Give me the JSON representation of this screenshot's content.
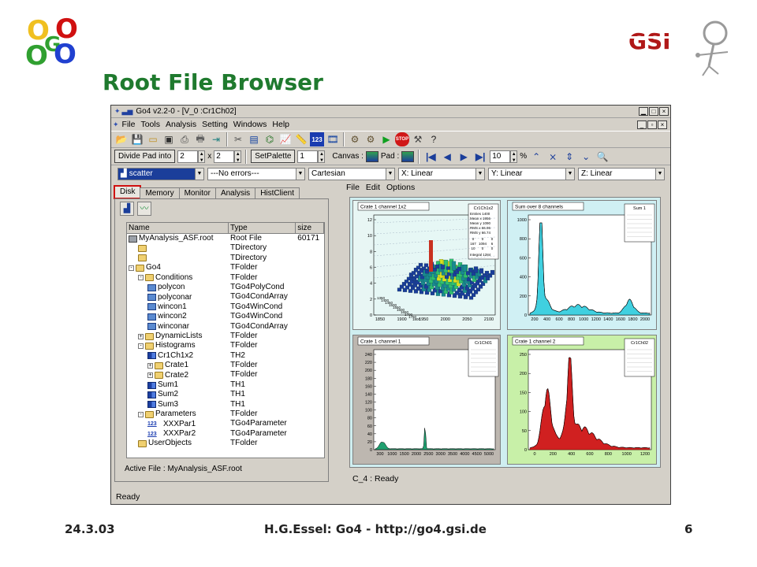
{
  "slide": {
    "title": "Root File Browser",
    "footer_date": "24.3.03",
    "footer_center": "H.G.Essel: Go4 - http://go4.gsi.de",
    "footer_page": "6",
    "logo_left_letters": [
      "O",
      "O",
      "G",
      "O",
      "O"
    ],
    "logo_right_text": "GSI"
  },
  "window": {
    "title": "Go4 v2.2-0 - [V_0 :Cr1Ch02]",
    "menu": [
      "File",
      "Tools",
      "Analysis",
      "Setting",
      "Windows",
      "Help"
    ],
    "toolbar_icons": [
      "open-icon",
      "save-icon",
      "folder-icon",
      "disk-icon",
      "print-icon",
      "printer-icon",
      "export-icon",
      "cut-icon",
      "monitor-icon",
      "tree-icon",
      "chart-icon",
      "ruler-icon",
      "counter-icon",
      "film-icon",
      "cog-icon",
      "cogs-icon",
      "play-icon",
      "stop-icon",
      "tools-icon",
      "help-icon"
    ],
    "toolbar_counter_label": "123",
    "toolbar_stop_label": "STOP",
    "divide_pad_label": "Divide Pad into",
    "divide_x": "2",
    "x_label": "x",
    "divide_y": "2",
    "setpalette_label": "SetPalette",
    "palette_value": "1",
    "canvas_label": "Canvas :",
    "pad_label": "Pad :",
    "zoom_value": "10",
    "zoom_unit": "%",
    "draw_option": "scatter",
    "error_option": "---No errors---",
    "coord_option": "Cartesian",
    "x_scale": "X: Linear",
    "y_scale": "Y: Linear",
    "z_scale": "Z: Linear",
    "status": "Ready"
  },
  "browser": {
    "tabs": [
      "Disk",
      "Memory",
      "Monitor",
      "Analysis",
      "HistClient"
    ],
    "active_tab": "Disk",
    "columns": [
      "Name",
      "Type",
      "size"
    ],
    "rows": [
      {
        "indent": 0,
        "icon": "file",
        "expand": "",
        "name": "MyAnalysis_ASF.root",
        "type": "Root File",
        "size": "60171"
      },
      {
        "indent": 1,
        "icon": "folder",
        "expand": "",
        "name": "",
        "type": "TDirectory",
        "size": ""
      },
      {
        "indent": 1,
        "icon": "folder",
        "expand": "",
        "name": "",
        "type": "TDirectory",
        "size": ""
      },
      {
        "indent": 0,
        "icon": "folder",
        "expand": "-",
        "name": "Go4",
        "type": "TFolder",
        "size": ""
      },
      {
        "indent": 1,
        "icon": "folder",
        "expand": "-",
        "name": "Conditions",
        "type": "TFolder",
        "size": ""
      },
      {
        "indent": 2,
        "icon": "cond",
        "expand": "",
        "name": "polycon",
        "type": "TGo4PolyCond",
        "size": ""
      },
      {
        "indent": 2,
        "icon": "cond",
        "expand": "",
        "name": "polyconar",
        "type": "TGo4CondArray",
        "size": ""
      },
      {
        "indent": 2,
        "icon": "cond",
        "expand": "",
        "name": "wincon1",
        "type": "TGo4WinCond",
        "size": ""
      },
      {
        "indent": 2,
        "icon": "cond",
        "expand": "",
        "name": "wincon2",
        "type": "TGo4WinCond",
        "size": ""
      },
      {
        "indent": 2,
        "icon": "cond",
        "expand": "",
        "name": "winconar",
        "type": "TGo4CondArray",
        "size": ""
      },
      {
        "indent": 1,
        "icon": "folder",
        "expand": "+",
        "name": "DynamicLists",
        "type": "TFolder",
        "size": ""
      },
      {
        "indent": 1,
        "icon": "folder",
        "expand": "-",
        "name": "Histograms",
        "type": "TFolder",
        "size": ""
      },
      {
        "indent": 2,
        "icon": "hist",
        "expand": "",
        "name": "Cr1Ch1x2",
        "type": "TH2",
        "size": ""
      },
      {
        "indent": 2,
        "icon": "folder",
        "expand": "+",
        "name": "Crate1",
        "type": "TFolder",
        "size": ""
      },
      {
        "indent": 2,
        "icon": "folder",
        "expand": "+",
        "name": "Crate2",
        "type": "TFolder",
        "size": ""
      },
      {
        "indent": 2,
        "icon": "hist",
        "expand": "",
        "name": "Sum1",
        "type": "TH1",
        "size": ""
      },
      {
        "indent": 2,
        "icon": "hist",
        "expand": "",
        "name": "Sum2",
        "type": "TH1",
        "size": ""
      },
      {
        "indent": 2,
        "icon": "hist",
        "expand": "",
        "name": "Sum3",
        "type": "TH1",
        "size": ""
      },
      {
        "indent": 1,
        "icon": "folder",
        "expand": "-",
        "name": "Parameters",
        "type": "TFolder",
        "size": ""
      },
      {
        "indent": 2,
        "icon": "par",
        "expand": "",
        "name": "XXXPar1",
        "type": "TGo4Parameter",
        "size": ""
      },
      {
        "indent": 2,
        "icon": "par",
        "expand": "",
        "name": "XXXPar2",
        "type": "TGo4Parameter",
        "size": ""
      },
      {
        "indent": 1,
        "icon": "folder",
        "expand": "",
        "name": "UserObjects",
        "type": "TFolder",
        "size": ""
      }
    ],
    "par_icon_label": "123",
    "active_file": "Active File : MyAnalysis_ASF.root"
  },
  "canvas": {
    "menu": [
      "File",
      "Edit",
      "Options"
    ],
    "status": "C_4 : Ready",
    "pads": [
      {
        "title": "Crate 1 channel 1x2",
        "stats_title": "Cr1Ch1x2",
        "stats": [
          "Entries 1400",
          "Mean x 1956",
          "Mean y 1090",
          "RMS x 66.96",
          "RMS y 66.74"
        ],
        "stats_grid": [
          [
            "0",
            "0",
            "0"
          ],
          [
            "167",
            "1094",
            "6"
          ],
          [
            "10",
            "0",
            "0"
          ]
        ],
        "stats_integral": "Integral 1284",
        "y_ticks": [
          "12",
          "10",
          "8",
          "6",
          "4",
          "2",
          "0"
        ],
        "x_ticks": [
          "1850",
          "1900",
          "1950",
          "2000",
          "2050",
          "2100"
        ],
        "side_ticks": [
          "1350",
          "1400",
          "1450",
          "1500",
          "1550",
          "1600",
          "1650",
          "1700",
          "1750",
          "1800"
        ],
        "color": "#2f9a8a",
        "bg": "#e6f7f5"
      },
      {
        "title": "Sum over 8 channels",
        "stats_title": "Sum 1",
        "y_ticks": [
          "1000",
          "800",
          "600",
          "400",
          "200",
          "0"
        ],
        "x_ticks": [
          "200",
          "400",
          "600",
          "800",
          "1000",
          "1200",
          "1400",
          "1600",
          "1800",
          "2000"
        ],
        "color": "#40d0e0",
        "bg": "#ffffff"
      },
      {
        "title": "Crate 1 channel 1",
        "stats_title": "Cr1Ch01",
        "y_ticks": [
          "240",
          "220",
          "200",
          "180",
          "160",
          "140",
          "120",
          "100",
          "80",
          "60",
          "40",
          "20",
          "0"
        ],
        "x_ticks": [
          "300",
          "1000",
          "1500",
          "2000",
          "2500",
          "3000",
          "3500",
          "4000",
          "4500",
          "5000"
        ],
        "color": "#20a070",
        "bg": "#ffffff"
      },
      {
        "title": "Crate 1 channel 2",
        "stats_title": "Cr1Ch02",
        "y_ticks": [
          "250",
          "200",
          "150",
          "100",
          "50",
          "0"
        ],
        "x_ticks": [
          "0",
          "200",
          "400",
          "600",
          "800",
          "1000",
          "1200"
        ],
        "color": "#d02020",
        "bg": "#ffffff"
      }
    ]
  },
  "colors": {
    "title_green": "#1f7a2e",
    "window_gray": "#d4d0c8",
    "canvas_bg": "#cfeef0",
    "selected_blue": "#1b3e9a",
    "highlight_red": "#d01010"
  }
}
